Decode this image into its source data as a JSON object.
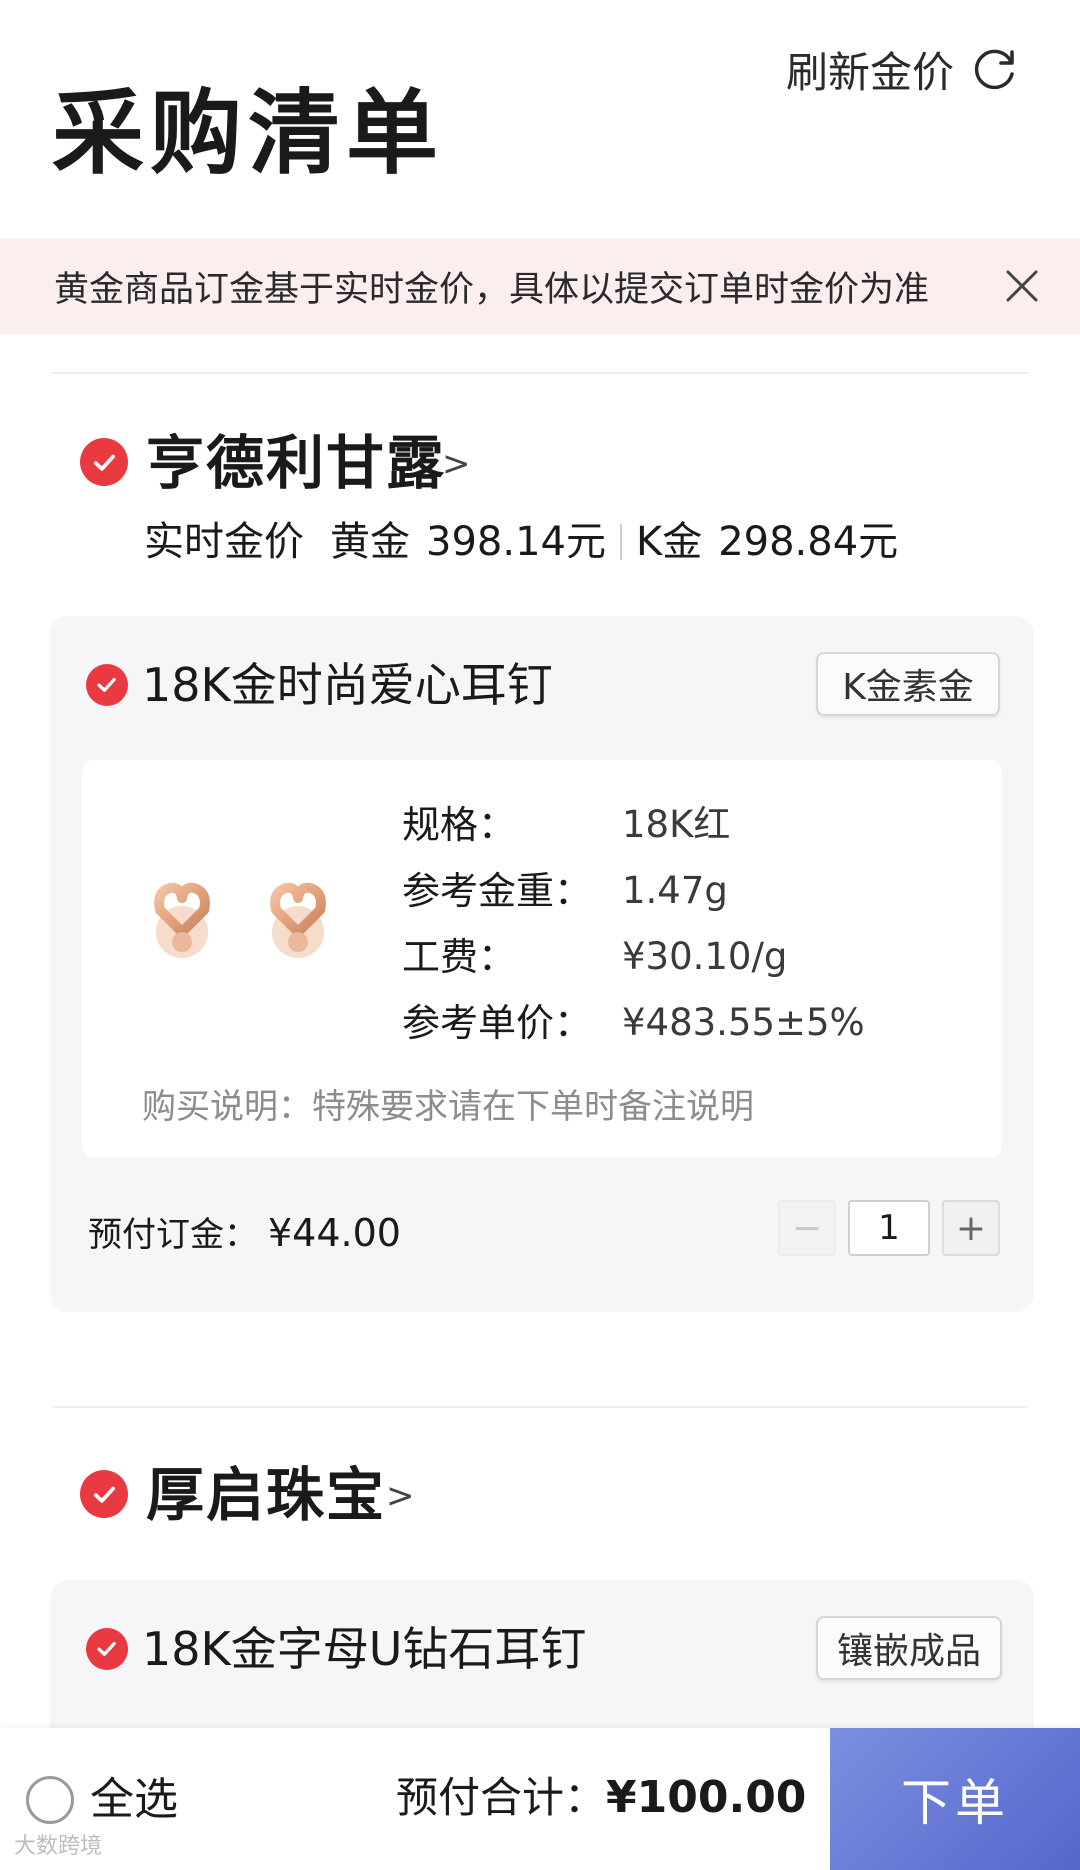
{
  "header": {
    "title": "采购清单",
    "refresh_label": "刷新金价",
    "refresh_icon": "refresh-icon"
  },
  "notice": {
    "text": "黄金商品订金基于实时金价，具体以提交订单时金价为准",
    "close_icon": "close-icon"
  },
  "stores": [
    {
      "name": "亨德利甘露",
      "chevron": ">",
      "realtime_label": "实时金价",
      "gold_label": "黄金",
      "gold_price": "398.14元",
      "kgold_label": "K金",
      "kgold_price": "298.84元",
      "products": [
        {
          "title": "18K金时尚爱心耳钉",
          "tag": "K金素金",
          "specs": [
            {
              "label": "规格：",
              "value": "18K红"
            },
            {
              "label": "参考金重：",
              "value": "1.47g"
            },
            {
              "label": "工费：",
              "value": "¥30.10/g"
            },
            {
              "label": "参考单价：",
              "value": "¥483.55±5%"
            }
          ],
          "note": "购买说明：特殊要求请在下单时备注说明",
          "deposit_label": "预付订金：",
          "deposit_value": "¥44.00",
          "quantity": "1",
          "minus": "−",
          "plus": "+"
        }
      ]
    },
    {
      "name": "厚启珠宝",
      "chevron": ">",
      "products": [
        {
          "title": "18K金字母U钻石耳钉",
          "tag": "镶嵌成品"
        }
      ]
    }
  ],
  "footer": {
    "select_all": "全选",
    "total_label": "预付合计：",
    "total_value": "¥100.00",
    "order_button": "下单",
    "watermark": "大数跨境"
  },
  "colors": {
    "accent_red": "#e83a40",
    "notice_bg": "#fbeeee",
    "card_bg": "#f6f5f8",
    "order_button": "#5c6fd2"
  }
}
